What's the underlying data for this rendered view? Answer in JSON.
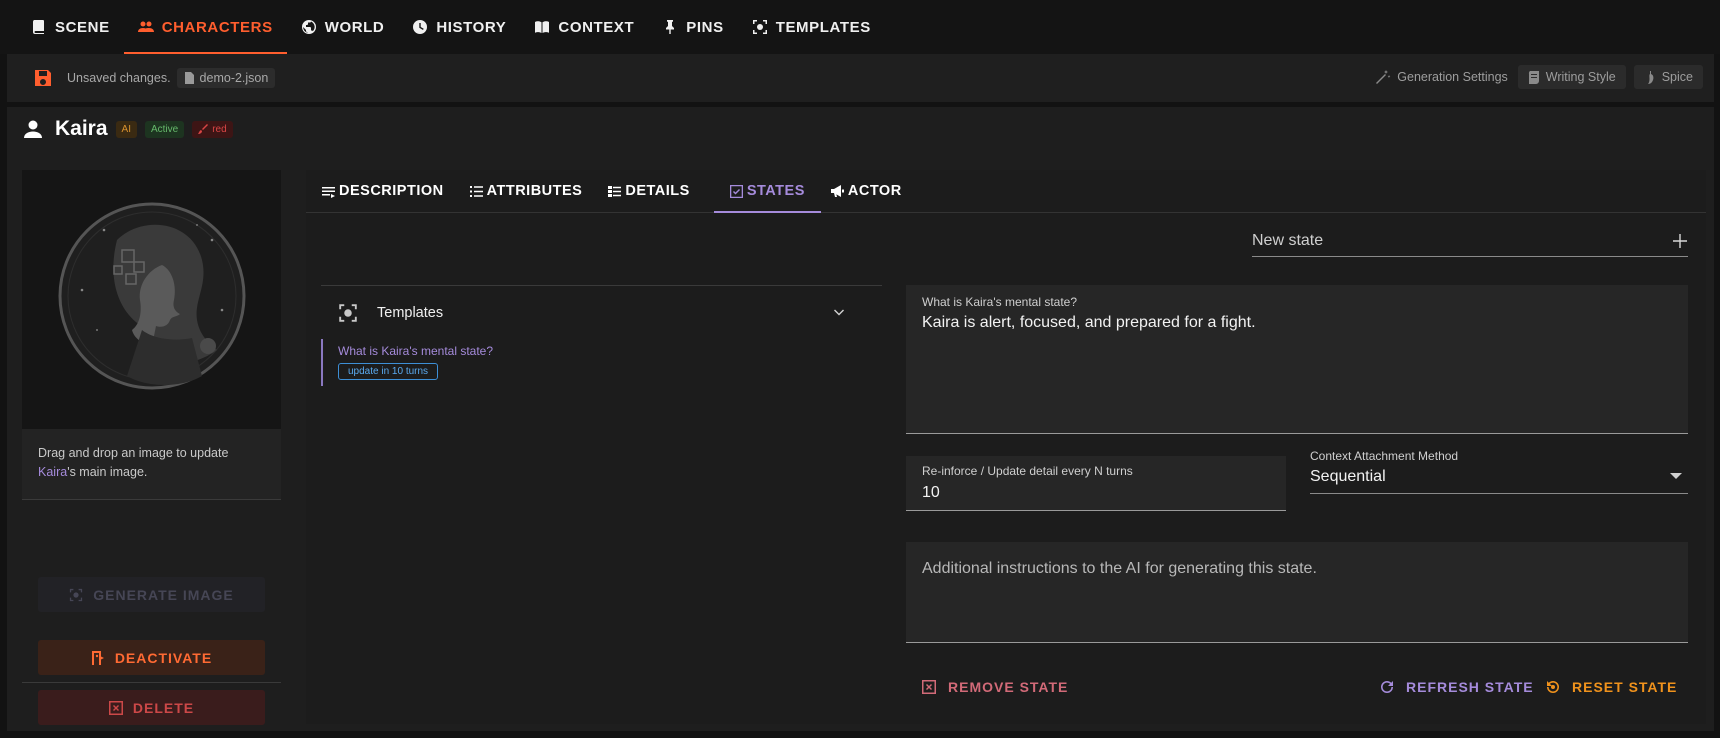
{
  "nav": {
    "items": [
      {
        "label": "SCENE",
        "icon": "book-icon"
      },
      {
        "label": "CHARACTERS",
        "icon": "people-icon"
      },
      {
        "label": "WORLD",
        "icon": "globe-icon"
      },
      {
        "label": "HISTORY",
        "icon": "clock-icon"
      },
      {
        "label": "CONTEXT",
        "icon": "open-book-icon"
      },
      {
        "label": "PINS",
        "icon": "pin-icon"
      },
      {
        "label": "TEMPLATES",
        "icon": "template-icon"
      }
    ],
    "active": "CHARACTERS",
    "accent": "#ff5e2e"
  },
  "status": {
    "unsaved": "Unsaved changes.",
    "file": "demo-2.json",
    "generation_settings": "Generation Settings",
    "writing_style": "Writing Style",
    "spice": "Spice"
  },
  "character": {
    "name": "Kaira",
    "badges": {
      "ai": "AI",
      "active": "Active",
      "color": "red"
    },
    "drop_text_pre": "Drag and drop an image to update ",
    "drop_text_name": "Kaira",
    "drop_text_post": "'s main image.",
    "generate_image": "GENERATE IMAGE",
    "deactivate": "DEACTIVATE",
    "delete": "DELETE"
  },
  "tabs": {
    "description": "DESCRIPTION",
    "attributes": "ATTRIBUTES",
    "details": "DETAILS",
    "states": "STATES",
    "actor": "ACTOR",
    "active": "STATES",
    "accent": "#a58bdb"
  },
  "states": {
    "new_state_placeholder": "New state",
    "templates_label": "Templates",
    "list": [
      {
        "question": "What is Kaira's mental state?",
        "chip": "update in 10 turns"
      }
    ],
    "selected": {
      "question_label": "What is Kaira's mental state?",
      "answer": "Kaira is alert, focused, and prepared for a fight.",
      "reinforce_label": "Re-inforce / Update detail every N turns",
      "reinforce_value": "10",
      "attach_label": "Context Attachment Method",
      "attach_value": "Sequential",
      "instructions_placeholder": "Additional instructions to the AI for generating this state."
    },
    "actions": {
      "remove": "REMOVE STATE",
      "refresh": "REFRESH STATE",
      "reset": "RESET STATE"
    }
  }
}
